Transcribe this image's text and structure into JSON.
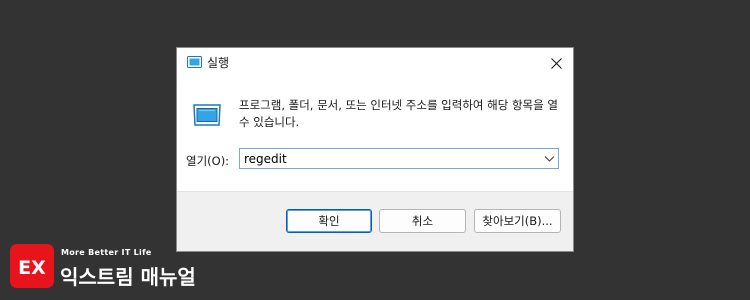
{
  "dialog": {
    "title": "실행",
    "close_icon": "close-icon",
    "description": "프로그램, 폴더, 문서, 또는 인터넷 주소를 입력하여 해당 항목을 열 수 있습니다.",
    "open_label": "열기(O):",
    "open_value": "regedit",
    "buttons": {
      "ok": "확인",
      "cancel": "취소",
      "browse": "찾아보기(B)..."
    }
  },
  "brand": {
    "tagline": "More Better IT Life",
    "name": "익스트림 매뉴얼",
    "logo_text": "EX",
    "accent_color": "#e8141c"
  }
}
